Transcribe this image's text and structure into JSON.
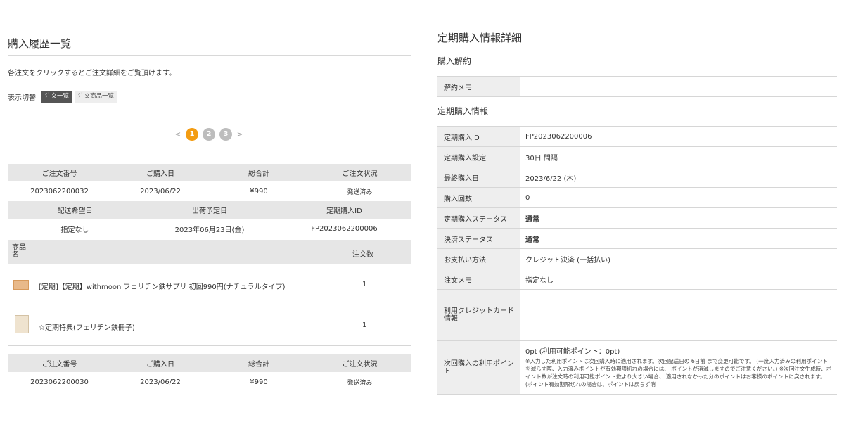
{
  "left": {
    "title": "購入履歴一覧",
    "description": "各注文をクリックするとご注文詳細をご覧頂けます。",
    "view_switch": {
      "label": "表示切替",
      "active": "注文一覧",
      "inactive": "注文商品一覧"
    },
    "pagination": {
      "prev": "<",
      "pages": [
        "1",
        "2",
        "3"
      ],
      "current": "1",
      "next": ">"
    },
    "order_headers": [
      "ご注文番号",
      "ご購入日",
      "総合計",
      "ご注文状況"
    ],
    "delivery_headers": [
      "配送希望日",
      "出荷予定日",
      "定期購入ID"
    ],
    "item_headers": {
      "name": "商品名",
      "qty": "注文数"
    },
    "orders": [
      {
        "number": "2023062200032",
        "date": "2023/06/22",
        "total": "¥990",
        "status": "発送済み",
        "delivery_wish": "指定なし",
        "ship_date": "2023年06月23日(金)",
        "sub_id": "FP2023062200006",
        "items": [
          {
            "name": "[定期]【定期】withmoon フェリチン鉄サプリ 初回990円(ナチュラルタイプ)",
            "qty": "1"
          },
          {
            "name": "☆定期特典(フェリチン鉄冊子)",
            "qty": "1"
          }
        ]
      },
      {
        "number": "2023062200030",
        "date": "2023/06/22",
        "total": "¥990",
        "status": "発送済み"
      }
    ]
  },
  "right": {
    "title": "定期購入情報詳細",
    "cancel_section": "購入解約",
    "cancel_memo_label": "解約メモ",
    "cancel_memo_value": "",
    "info_section": "定期購入情報",
    "rows": [
      {
        "label": "定期購入ID",
        "value": "FP2023062200006"
      },
      {
        "label": "定期購入設定",
        "value": "30日 間隔"
      },
      {
        "label": "最終購入日",
        "value": "2023/6/22 (木)"
      },
      {
        "label": "購入回数",
        "value": "0"
      },
      {
        "label": "定期購入ステータス",
        "value": "通常"
      },
      {
        "label": "決済ステータス",
        "value": "通常"
      },
      {
        "label": "お支払い方法",
        "value": "クレジット決済 (一括払い)"
      },
      {
        "label": "注文メモ",
        "value": "指定なし"
      }
    ],
    "card_label": "利用クレジットカード情報",
    "card_value": "",
    "points_label": "次回購入の利用ポイント",
    "points_value": "0pt (利用可能ポイント：0pt)",
    "points_note": "※入力した利用ポイントは次回購入時に適用されます。次回配送日の 6日前 まで変更可能です。 (一度入力済みの利用ポイントを減らす際、入力済みポイントが有効期限切れの場合には、 ポイントが消滅しますのでご注意ください。) ※次回注文生成時、ポイント数が注文時の利用可能ポイント数より大きい場合、 適用されなかった分のポイントはお客様のポイントに戻されます。 (ポイント有効期限切れの場合は、ポイントは戻らず消"
  }
}
